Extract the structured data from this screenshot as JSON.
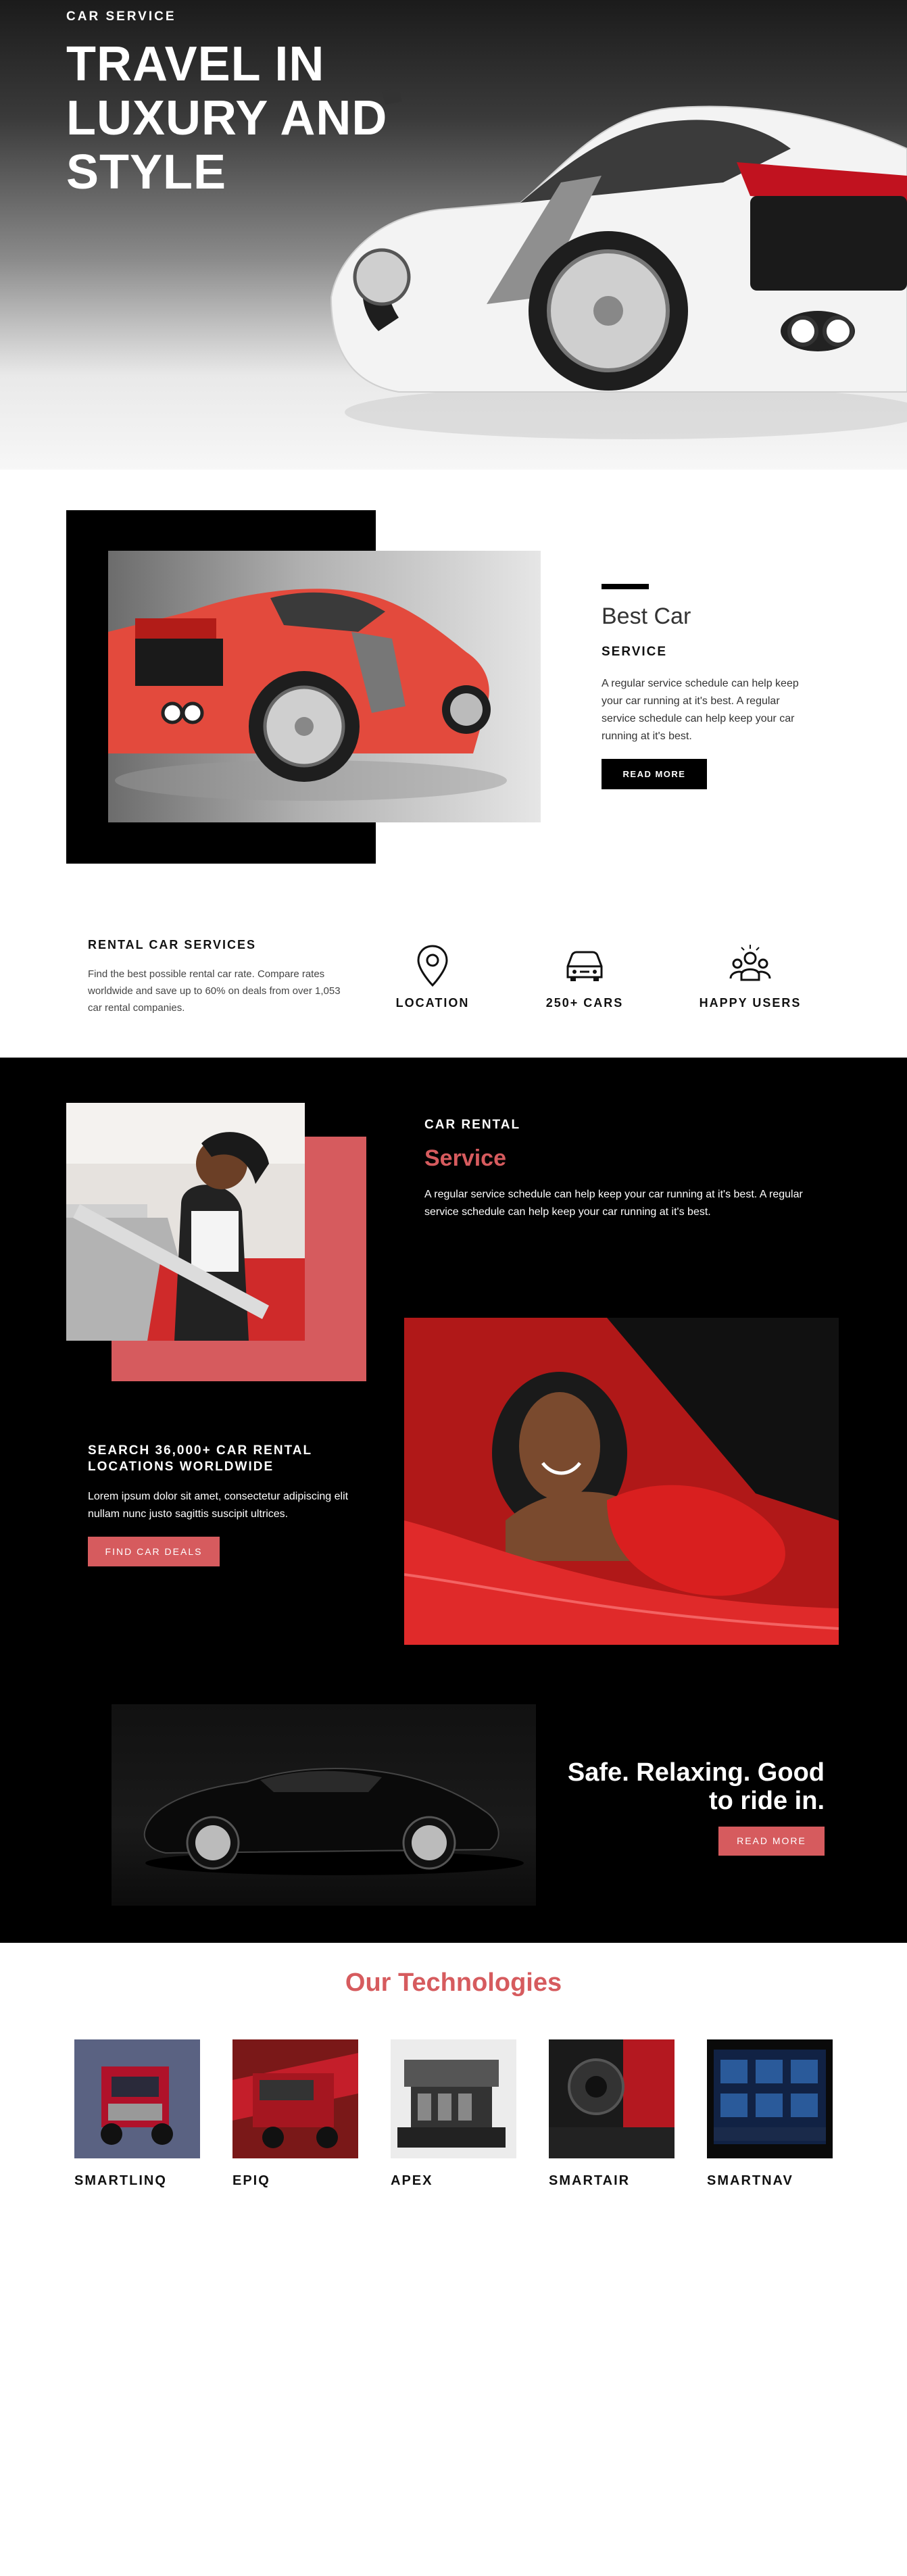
{
  "hero": {
    "eyebrow": "CAR SERVICE",
    "title": "TRAVEL IN LUXURY AND STYLE"
  },
  "best_car": {
    "title": "Best Car",
    "subtitle": "SERVICE",
    "text": "A regular service schedule can help keep your car running at it's best. A regular service schedule can help keep your car running at it's best.",
    "button": "READ MORE"
  },
  "rental": {
    "title": "RENTAL CAR SERVICES",
    "text": "Find the best possible rental car rate. Compare rates worldwide and save up to 60% on deals from over 1,053 car rental companies.",
    "features": [
      {
        "icon": "location-pin-icon",
        "label": "LOCATION"
      },
      {
        "icon": "car-front-icon",
        "label": "250+ CARS"
      },
      {
        "icon": "happy-users-icon",
        "label": "HAPPY USERS"
      }
    ]
  },
  "car_rental": {
    "eyebrow": "CAR RENTAL",
    "title": "Service",
    "text": "A regular service schedule can help keep your car running at it's best. A regular service schedule can help keep your car running at it's best."
  },
  "search": {
    "title": "SEARCH 36,000+ CAR RENTAL LOCATIONS WORLDWIDE",
    "text": "Lorem ipsum dolor sit amet, consectetur adipiscing elit nullam nunc justo sagittis suscipit ultrices.",
    "button": "FIND CAR DEALS"
  },
  "safe": {
    "title": "Safe. Relaxing. Good to ride in.",
    "button": "READ MORE"
  },
  "technologies": {
    "title": "Our Technologies",
    "items": [
      {
        "label": "SMARTLINQ"
      },
      {
        "label": "EPIQ"
      },
      {
        "label": "APEX"
      },
      {
        "label": "SMARTAIR"
      },
      {
        "label": "SMARTNAV"
      }
    ]
  },
  "colors": {
    "accent": "#d65b5e",
    "dark": "#000000"
  }
}
